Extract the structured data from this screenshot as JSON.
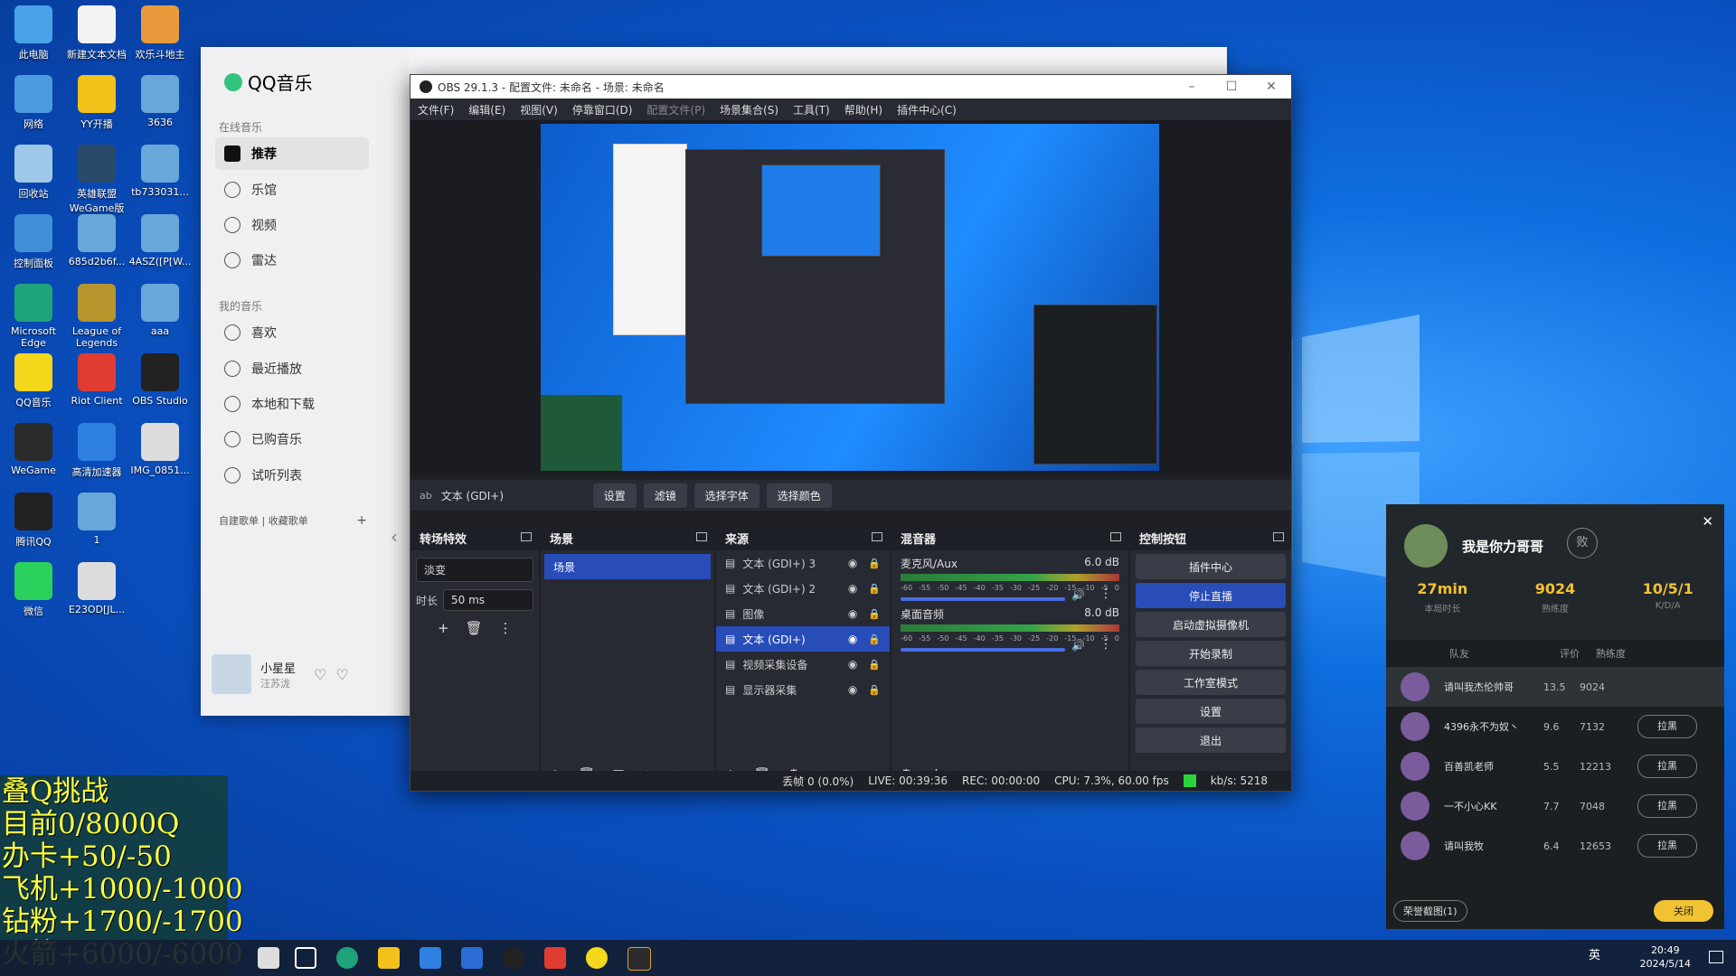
{
  "desktop": {
    "col1": [
      {
        "label": "此电脑",
        "color": "#4aa3e8"
      },
      {
        "label": "网络",
        "color": "#4a9be0"
      },
      {
        "label": "回收站",
        "color": "#9fc7e8"
      },
      {
        "label": "控制面板",
        "color": "#3f8fd9"
      },
      {
        "label": "Microsoft Edge",
        "color": "#1fa37a"
      },
      {
        "label": "QQ音乐",
        "color": "#f4d81c"
      },
      {
        "label": "WeGame",
        "color": "#2b2b2b"
      },
      {
        "label": "腾讯QQ",
        "color": "#222222"
      },
      {
        "label": "微信",
        "color": "#2ad15c"
      }
    ],
    "col2": [
      {
        "label": "新建文本文档",
        "color": "#f2f2f2"
      },
      {
        "label": "YY开播",
        "color": "#f2c21a"
      },
      {
        "label": "英雄联盟WeGame版",
        "color": "#2b4a6a"
      },
      {
        "label": "685d2b6f...",
        "color": "#6aa7d9"
      },
      {
        "label": "League of Legends",
        "color": "#b8952d"
      },
      {
        "label": "Riot Client",
        "color": "#e03c31"
      },
      {
        "label": "高清加速器",
        "color": "#2d7fe0"
      },
      {
        "label": "1",
        "color": "#6aa7d9"
      },
      {
        "label": "E23OD[JL...",
        "color": "#dddddd"
      }
    ],
    "col3": [
      {
        "label": "欢乐斗地主",
        "color": "#e89a3c"
      },
      {
        "label": "3636",
        "color": "#6aa7d9"
      },
      {
        "label": "tb733031...",
        "color": "#6aa7d9"
      },
      {
        "label": "4ASZ([P[W...",
        "color": "#6aa7d9"
      },
      {
        "label": "aaa",
        "color": "#6aa7d9"
      },
      {
        "label": "OBS Studio",
        "color": "#222222"
      },
      {
        "label": "IMG_0851...",
        "color": "#dddddd"
      }
    ]
  },
  "qqmusic": {
    "app_name": "QQ音乐",
    "online_section": "在线音乐",
    "online_items": [
      "推荐",
      "乐馆",
      "视频",
      "雷达"
    ],
    "my_section": "我的音乐",
    "my_items": [
      "喜欢",
      "最近播放",
      "本地和下载",
      "已购音乐",
      "试听列表"
    ],
    "playlist_tabs": [
      "自建歌单",
      "收藏歌单"
    ],
    "add_symbol": "+",
    "now_playing": {
      "title": "小星星",
      "artist": "汪苏泷"
    }
  },
  "obs": {
    "title": "OBS 29.1.3 - 配置文件: 未命名 - 场景: 未命名",
    "menu": [
      "文件(F)",
      "编辑(E)",
      "视图(V)",
      "停靠窗口(D)",
      "配置文件(P)",
      "场景集合(S)",
      "工具(T)",
      "帮助(H)",
      "插件中心(C)"
    ],
    "source_bar": {
      "selected": "文本 (GDI+)",
      "buttons": [
        "设置",
        "滤镜",
        "选择字体",
        "选择颜色"
      ]
    },
    "transitions": {
      "header": "转场特效",
      "effect": "淡变",
      "duration_label": "时长",
      "duration": "50 ms"
    },
    "scenes": {
      "header": "场景",
      "items": [
        "场景"
      ]
    },
    "sources": {
      "header": "来源",
      "items": [
        "文本 (GDI+) 3",
        "文本 (GDI+) 2",
        "图像",
        "文本 (GDI+)",
        "视频采集设备",
        "显示器采集"
      ],
      "active_index": 3
    },
    "mixer": {
      "header": "混音器",
      "channels": [
        {
          "name": "麦克风/Aux",
          "level": "6.0 dB"
        },
        {
          "name": "桌面音频",
          "level": "8.0 dB"
        }
      ],
      "scale": [
        "-60",
        "-55",
        "-50",
        "-45",
        "-40",
        "-35",
        "-30",
        "-25",
        "-20",
        "-15",
        "-10",
        "-5",
        "0"
      ]
    },
    "controls": {
      "header": "控制按钮",
      "buttons": [
        "插件中心",
        "停止直播",
        "启动虚拟摄像机",
        "开始录制",
        "工作室模式",
        "设置",
        "退出"
      ]
    },
    "status": {
      "dropped": "丢帧 0 (0.0%)",
      "live": "LIVE: 00:39:36",
      "rec": "REC: 00:00:00",
      "cpu": "CPU: 7.3%, 60.00 fps",
      "kbps": "kb/s: 5218"
    }
  },
  "game": {
    "player_name": "我是你力哥哥",
    "badge": "败",
    "stats": [
      {
        "value": "27min",
        "label": "本局时长"
      },
      {
        "value": "9024",
        "label": "熟练度"
      },
      {
        "value": "10/5/1",
        "label": "K/D/A"
      }
    ],
    "columns": [
      "队友",
      "评价",
      "熟练度"
    ],
    "teammates": [
      {
        "name": "请叫我杰伦帅哥",
        "rating": "13.5",
        "mastery": "9024",
        "pull": ""
      },
      {
        "name": "4396永不为奴丶",
        "rating": "9.6",
        "mastery": "7132",
        "pull": "拉黑"
      },
      {
        "name": "百善凯老师",
        "rating": "5.5",
        "mastery": "12213",
        "pull": "拉黑"
      },
      {
        "name": "一不小心KK",
        "rating": "7.7",
        "mastery": "7048",
        "pull": "拉黑"
      },
      {
        "name": "请叫我牧",
        "rating": "6.4",
        "mastery": "12653",
        "pull": "拉黑"
      }
    ],
    "screenshot_button": "荣誉截图(1)",
    "close_button": "关闭"
  },
  "overlay": {
    "lines": [
      "叠Q挑战",
      "目前0/8000Q",
      "办卡+50/-50",
      "飞机+1000/-1000",
      "钻粉+1700/-1700",
      "火箭+6000/-6000"
    ]
  },
  "taskbar": {
    "ime": "英",
    "time": "20:49",
    "date": "2024/5/14"
  }
}
